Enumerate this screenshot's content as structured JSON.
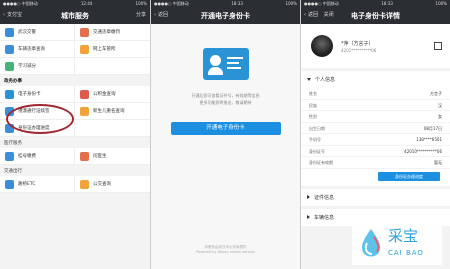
{
  "screen1": {
    "status_left": "●●●●○ 中国移动",
    "status_time": "12:44",
    "status_right": "100%",
    "back": "支付宝",
    "title": "城市服务",
    "share": "分享",
    "top_items": [
      "武汉交警",
      "交通违章缴罚",
      "车辆违章查询",
      "网上车管所",
      "学习减分",
      ""
    ],
    "section_hl": "政务办事",
    "hl_items": [
      "电子身份卡",
      "公积金查询",
      "港澳通行证续签",
      "新生儿重名查询",
      "身份证办理进度",
      ""
    ],
    "section_med": "医疗服务",
    "med_items": [
      "挂号缴费",
      "问医生"
    ],
    "section_traffic": "交通出行",
    "traffic_items": [
      "路桥ETC",
      "公交查询"
    ]
  },
  "screen2": {
    "status_left": "●●●●○ 中国移动",
    "status_time": "18:33",
    "status_right": "100%",
    "back": "返回",
    "title": "开通电子身份卡",
    "desc": "开通后即可查看证件号，有效期等信息\n更多功能即将推出，敬请期待",
    "button": "开通电子身份卡",
    "footer": "本服务由武汉市公安局提供\nPowered by Alipay citizen service"
  },
  "screen3": {
    "status_left": "●●●●○ 中国移动",
    "status_time": "18:33",
    "status_right": "100%",
    "back": "返回",
    "close": "关闭",
    "title": "电子身份卡详情",
    "name_line": "*萍（方言子）",
    "id_line": "4201**********06",
    "section_personal": "个人信息",
    "fields": [
      {
        "k": "姓名",
        "v": "方言子"
      },
      {
        "k": "民族",
        "v": "汉"
      },
      {
        "k": "性别",
        "v": "女"
      },
      {
        "k": "出生日期",
        "v": "08月17日"
      },
      {
        "k": "手机号",
        "v": "138****6501"
      },
      {
        "k": "身份证号",
        "v": "42010**********06"
      },
      {
        "k": "身份证有效期",
        "v": "暂无"
      }
    ],
    "download": "身份证办理进度",
    "section_cert": "证件信息",
    "section_vehicle": "车辆信息"
  },
  "watermark": {
    "cn": "采宝",
    "en": "CAI BAO"
  },
  "colors": {
    "nav": "#2b2f33",
    "accent": "#1d8fe1",
    "highlight_circle": "#a3272e"
  }
}
